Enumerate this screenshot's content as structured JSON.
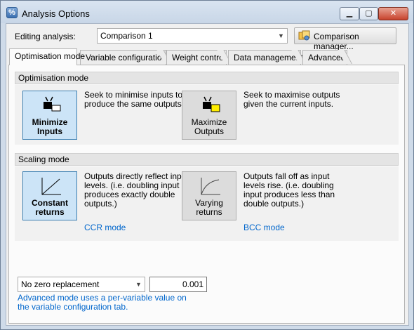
{
  "window": {
    "title": "Analysis Options",
    "app_icon_glyph": "%",
    "minimize_glyph": "▁",
    "maximize_glyph": "▢",
    "close_glyph": "✕"
  },
  "header": {
    "editing_label": "Editing analysis:",
    "analysis_value": "Comparison 1",
    "comparison_manager_label": "Comparison manager..."
  },
  "tabs": [
    {
      "label": "Optimisation mode",
      "active": true
    },
    {
      "label": "Variable configuration",
      "active": false
    },
    {
      "label": "Weight control",
      "active": false
    },
    {
      "label": "Data management",
      "active": false
    },
    {
      "label": "Advanced",
      "active": false
    }
  ],
  "optimisation": {
    "header": "Optimisation mode",
    "minimize_label": "Minimize Inputs",
    "minimize_desc": "Seek to minimise inputs to produce the same outputs.",
    "maximize_label": "Maximize Outputs",
    "maximize_desc": "Seek to maximise outputs given the current inputs.",
    "selected": "Minimize Inputs"
  },
  "scaling": {
    "header": "Scaling mode",
    "constant_label": "Constant returns",
    "constant_desc": "Outputs directly reflect input levels. (i.e. doubling input produces exactly double outputs.)",
    "constant_link": "CCR mode",
    "varying_label": "Varying returns",
    "varying_desc": "Outputs fall off as input levels rise. (i.e. doubling input produces less than double outputs.)",
    "varying_link": "BCC mode",
    "selected": "Constant returns"
  },
  "zero_replacement": {
    "selected": "No zero replacement",
    "value": "0.001",
    "note": "Advanced mode uses a per-variable value on the variable configuration tab."
  },
  "colors": {
    "accent_link": "#0066cc",
    "selected_fill": "#cce4f7",
    "selected_border": "#3c7fb1",
    "close_button": "#c7432d"
  },
  "icons": [
    "app-icon",
    "minimize-icon",
    "maximize-icon",
    "close-icon",
    "dropdown-arrow-icon",
    "comparison-manager-icon",
    "minimize-inputs-icon",
    "maximize-outputs-icon",
    "constant-returns-icon",
    "varying-returns-icon"
  ]
}
